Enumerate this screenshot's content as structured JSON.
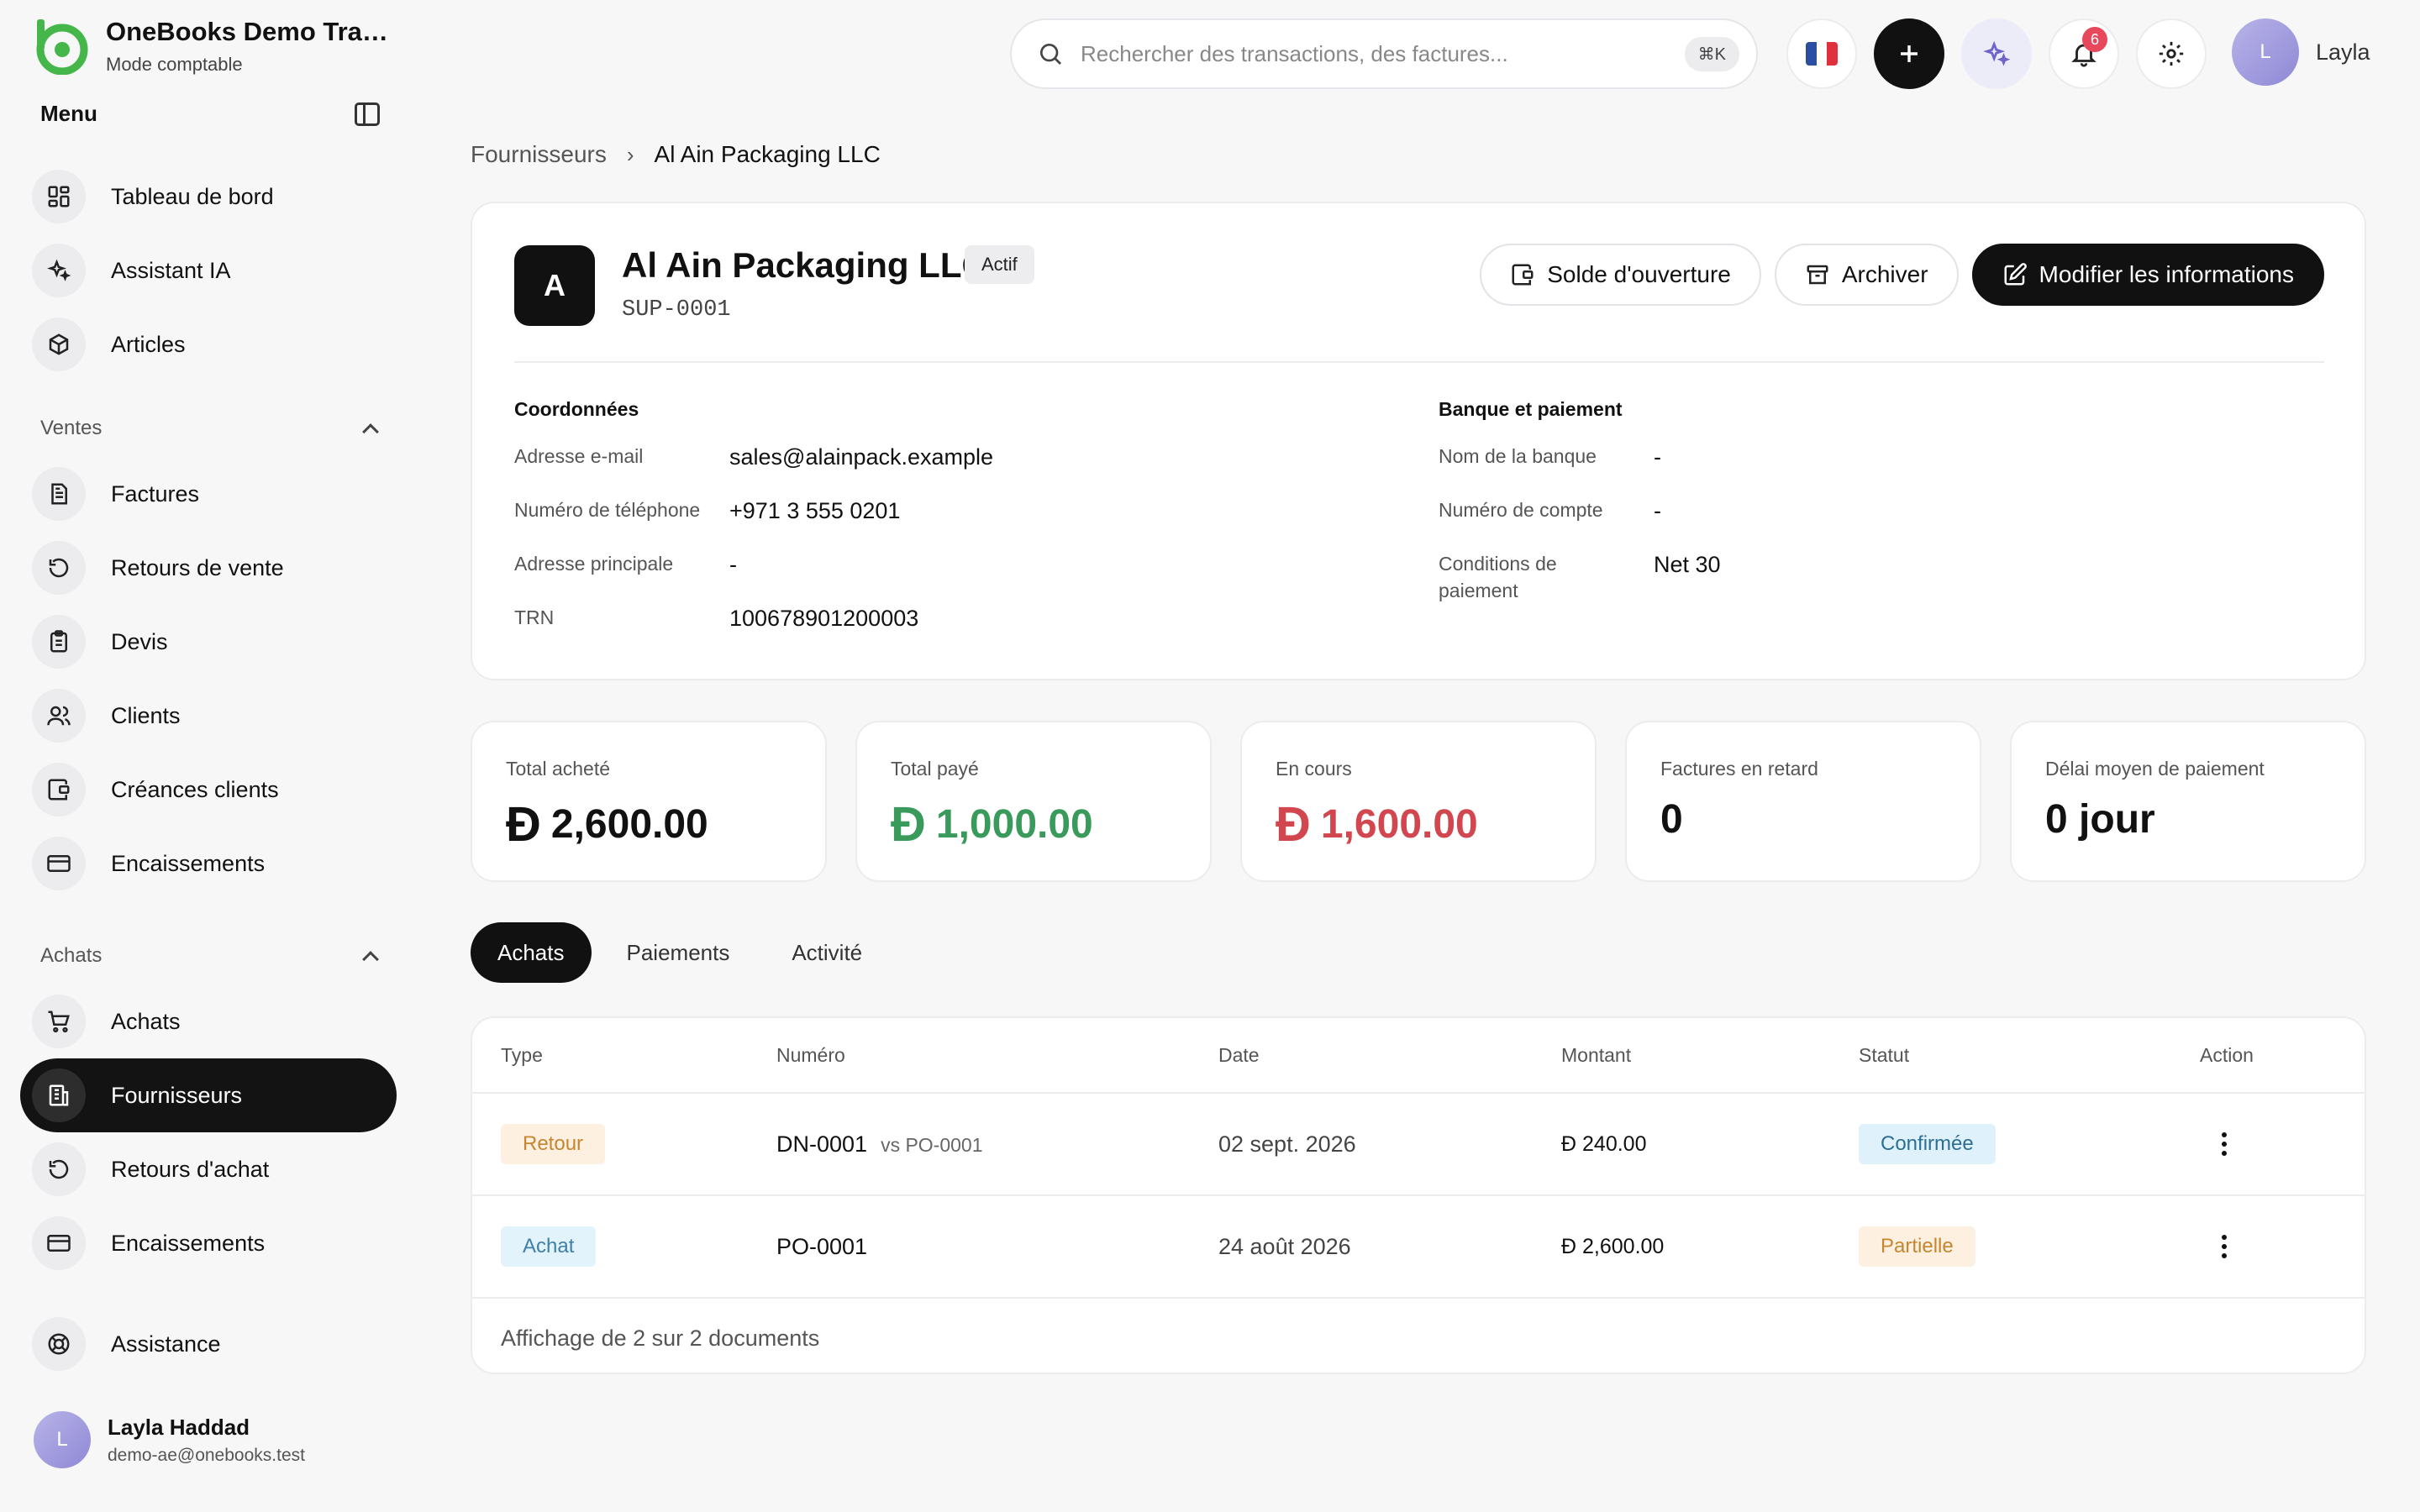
{
  "brand": {
    "name": "OneBooks Demo Trading",
    "subtitle": "Mode comptable"
  },
  "menu": {
    "title": "Menu"
  },
  "nav_top": [
    {
      "label": "Tableau de bord",
      "icon": "dashboard-icon"
    },
    {
      "label": "Assistant IA",
      "icon": "sparkles-icon"
    },
    {
      "label": "Articles",
      "icon": "box-icon"
    }
  ],
  "sections": {
    "ventes": {
      "title": "Ventes",
      "items": [
        {
          "label": "Factures",
          "icon": "invoice-icon"
        },
        {
          "label": "Retours de vente",
          "icon": "return-icon"
        },
        {
          "label": "Devis",
          "icon": "quote-icon"
        },
        {
          "label": "Clients",
          "icon": "users-icon"
        },
        {
          "label": "Créances clients",
          "icon": "wallet-icon"
        },
        {
          "label": "Encaissements",
          "icon": "card-icon"
        }
      ]
    },
    "achats": {
      "title": "Achats",
      "items": [
        {
          "label": "Achats",
          "icon": "cart-icon"
        },
        {
          "label": "Fournisseurs",
          "icon": "building-icon",
          "active": true
        },
        {
          "label": "Retours d'achat",
          "icon": "return-icon"
        },
        {
          "label": "Encaissements",
          "icon": "card-icon"
        }
      ]
    }
  },
  "support": {
    "label": "Assistance",
    "icon": "lifebuoy-icon"
  },
  "user": {
    "initial": "L",
    "name": "Layla Haddad",
    "email": "demo-ae@onebooks.test",
    "short_name": "Layla"
  },
  "search": {
    "placeholder": "Rechercher des transactions, des factures...",
    "shortcut": "⌘K"
  },
  "notifications": {
    "count": "6"
  },
  "breadcrumb": {
    "parent": "Fournisseurs",
    "current": "Al Ain Packaging LLC"
  },
  "supplier": {
    "initial": "A",
    "name": "Al Ain Packaging LLC",
    "status": "Actif",
    "code": "SUP-0001",
    "actions": {
      "opening_balance": "Solde d'ouverture",
      "archive": "Archiver",
      "edit": "Modifier les informations"
    },
    "contact": {
      "title": "Coordonnées",
      "rows": [
        {
          "label": "Adresse e-mail",
          "value": "sales@alainpack.example"
        },
        {
          "label": "Numéro de téléphone",
          "value": "+971 3 555 0201"
        },
        {
          "label": "Adresse principale",
          "value": "-"
        },
        {
          "label": "TRN",
          "value": "100678901200003"
        }
      ]
    },
    "bank": {
      "title": "Banque et paiement",
      "rows": [
        {
          "label": "Nom de la banque",
          "value": "-"
        },
        {
          "label": "Numéro de compte",
          "value": "-"
        },
        {
          "label": "Conditions de paiement",
          "value": "Net 30"
        }
      ]
    }
  },
  "stats": [
    {
      "label": "Total acheté",
      "currency": "Đ",
      "value": "2,600.00",
      "color": "#111111"
    },
    {
      "label": "Total payé",
      "currency": "Đ",
      "value": "1,000.00",
      "color": "#3a9a5b"
    },
    {
      "label": "En cours",
      "currency": "Đ",
      "value": "1,600.00",
      "color": "#d2464f"
    },
    {
      "label": "Factures en retard",
      "currency": "",
      "value": "0",
      "color": "#111111"
    },
    {
      "label": "Délai moyen de paiement",
      "currency": "",
      "value": "0 jour",
      "color": "#111111"
    }
  ],
  "tabs": [
    {
      "label": "Achats",
      "active": true
    },
    {
      "label": "Paiements"
    },
    {
      "label": "Activité"
    }
  ],
  "table": {
    "headers": [
      "Type",
      "Numéro",
      "Date",
      "Montant",
      "Statut",
      "Action"
    ],
    "rows": [
      {
        "type": "Retour",
        "number": "DN-0001",
        "ref": "vs PO-0001",
        "date": "02 sept. 2026",
        "currency": "Đ",
        "amount": "240.00",
        "status": "Confirmée"
      },
      {
        "type": "Achat",
        "number": "PO-0001",
        "ref": "",
        "date": "24 août 2026",
        "currency": "Đ",
        "amount": "2,600.00",
        "status": "Partielle"
      }
    ],
    "footer": "Affichage de 2 sur 2 documents"
  },
  "colors": {
    "accent": "#111111",
    "brand_green": "#45b649",
    "positive": "#3a9a5b",
    "negative": "#d2464f"
  }
}
